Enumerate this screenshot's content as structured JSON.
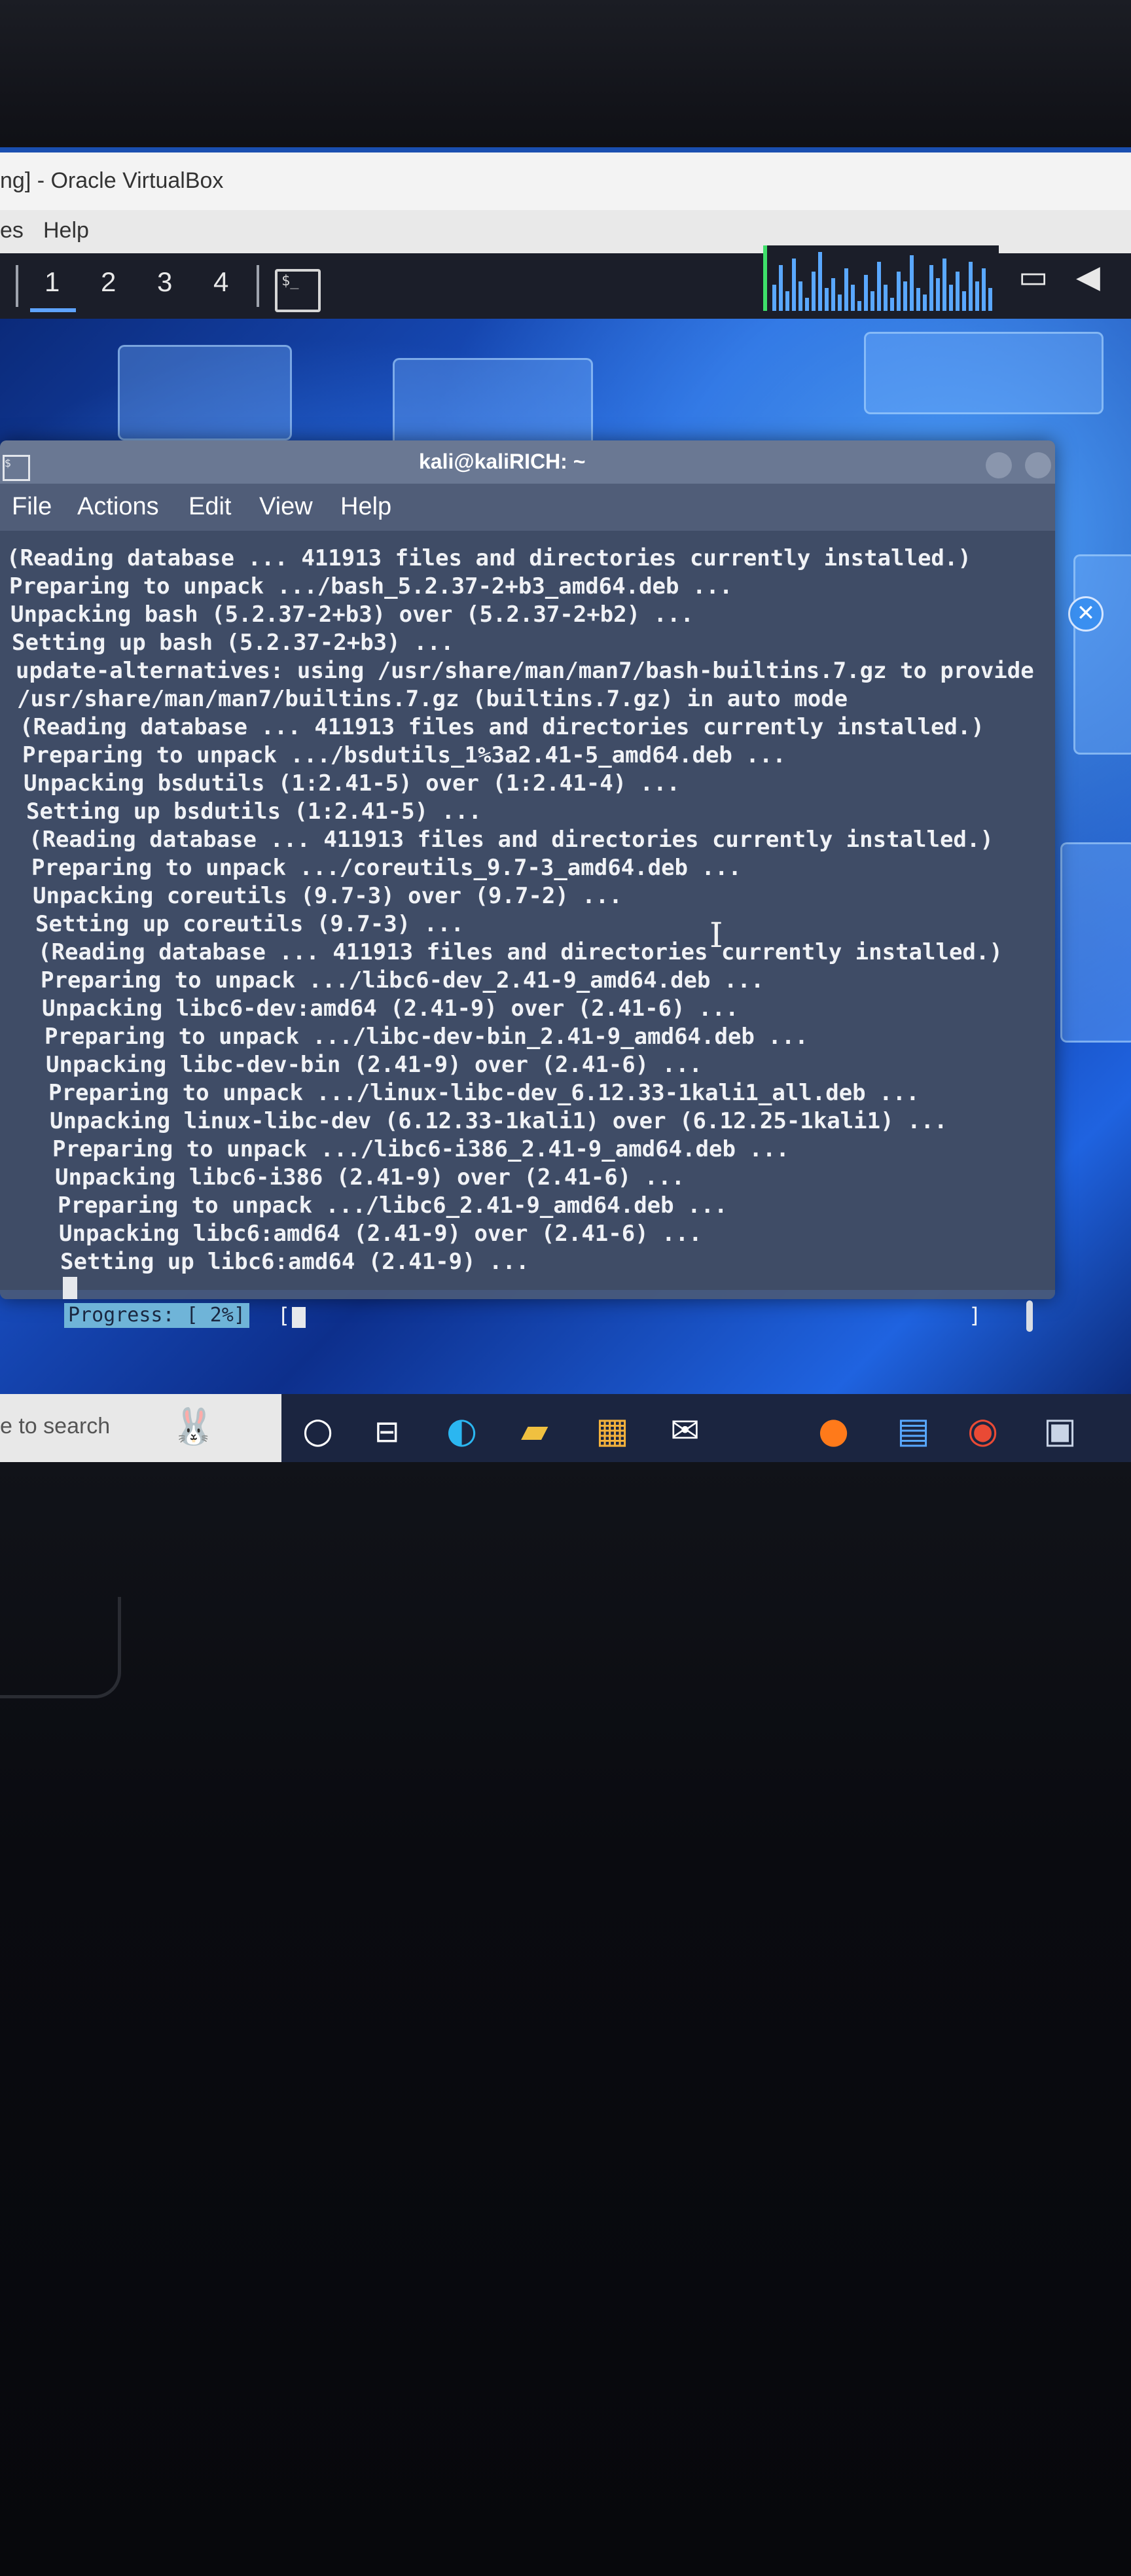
{
  "vbox": {
    "title": "ng] - Oracle VirtualBox",
    "menu": [
      "es",
      "Help"
    ]
  },
  "panel": {
    "workspaces": [
      "1",
      "2",
      "3",
      "4"
    ],
    "terminal_launcher_glyph": "$_"
  },
  "terminal": {
    "title": "kali@kaliRICH: ~",
    "menu": [
      "File",
      "Actions",
      "Edit",
      "View",
      "Help"
    ],
    "lines": [
      "(Reading database ... 411913 files and directories currently installed.)",
      "Preparing to unpack .../bash_5.2.37-2+b3_amd64.deb ...",
      "Unpacking bash (5.2.37-2+b3) over (5.2.37-2+b2) ...",
      "Setting up bash (5.2.37-2+b3) ...",
      "update-alternatives: using /usr/share/man/man7/bash-builtins.7.gz to provide",
      "/usr/share/man/man7/builtins.7.gz (builtins.7.gz) in auto mode",
      "(Reading database ... 411913 files and directories currently installed.)",
      "Preparing to unpack .../bsdutils_1%3a2.41-5_amd64.deb ...",
      "Unpacking bsdutils (1:2.41-5) over (1:2.41-4) ...",
      "Setting up bsdutils (1:2.41-5) ...",
      "(Reading database ... 411913 files and directories currently installed.)",
      "Preparing to unpack .../coreutils_9.7-3_amd64.deb ...",
      "Unpacking coreutils (9.7-3) over (9.7-2) ...",
      "Setting up coreutils (9.7-3) ...",
      "(Reading database ... 411913 files and directories currently installed.)",
      "Preparing to unpack .../libc6-dev_2.41-9_amd64.deb ...",
      "Unpacking libc6-dev:amd64 (2.41-9) over (2.41-6) ...",
      "Preparing to unpack .../libc-dev-bin_2.41-9_amd64.deb ...",
      "Unpacking libc-dev-bin (2.41-9) over (2.41-6) ...",
      "Preparing to unpack .../linux-libc-dev_6.12.33-1kali1_all.deb ...",
      "Unpacking linux-libc-dev (6.12.33-1kali1) over (6.12.25-1kali1) ...",
      "Preparing to unpack .../libc6-i386_2.41-9_amd64.deb ...",
      "Unpacking libc6-i386 (2.41-9) over (2.41-6) ...",
      "Preparing to unpack .../libc6_2.41-9_amd64.deb ...",
      "Unpacking libc6:amd64 (2.41-9) over (2.41-6) ...",
      "Setting up libc6:amd64 (2.41-9) ..."
    ],
    "progress_label": "Progress: [  2%]",
    "progress_open": "[",
    "progress_close": "]",
    "progress_percent": 2
  },
  "taskbar": {
    "search_text": "e to search",
    "icons": [
      "cortana-icon",
      "task-view-icon",
      "edge-icon",
      "file-explorer-icon",
      "store-icon",
      "mail-icon",
      "firefox-icon",
      "app-icon",
      "chrome-icon",
      "virtualbox-icon"
    ]
  },
  "colors": {
    "terminal_bg": "#3f4c66",
    "terminal_text": "#f0f2f6",
    "progress_bg": "#6fb4d8",
    "accent": "#3a8ff0"
  }
}
